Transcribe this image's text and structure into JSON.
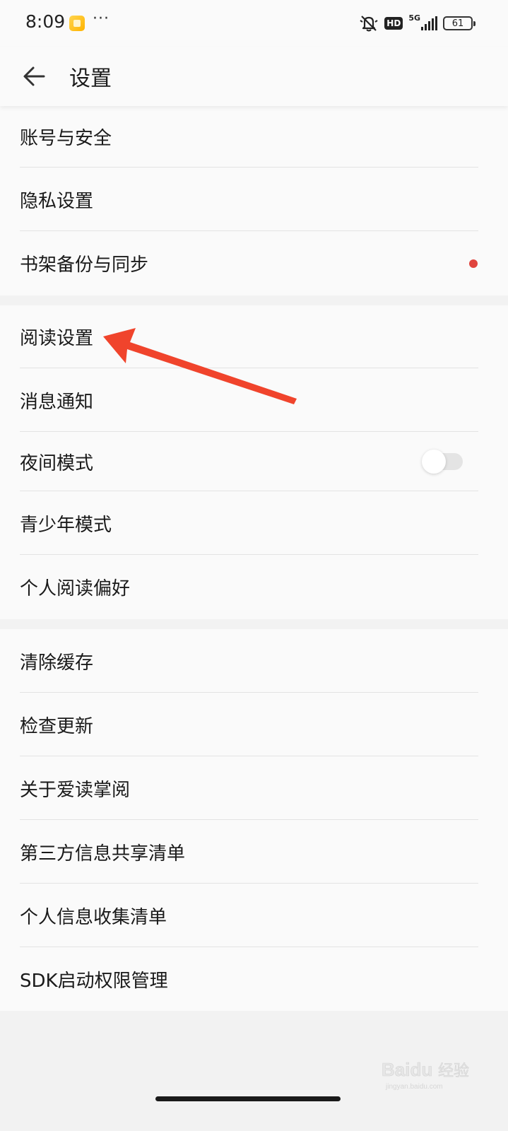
{
  "status_bar": {
    "time": "8:09",
    "network_badge": "HD",
    "network_type": "5G",
    "battery_level": "61",
    "more_dots": "···"
  },
  "app_bar": {
    "title": "设置",
    "back_icon": "arrow-left-icon"
  },
  "groups": [
    {
      "items": [
        {
          "label": "账号与安全"
        },
        {
          "label": "隐私设置"
        },
        {
          "label": "书架备份与同步",
          "badge": "red-dot"
        }
      ]
    },
    {
      "items": [
        {
          "label": "阅读设置"
        },
        {
          "label": "消息通知"
        },
        {
          "label": "夜间模式",
          "toggle": false
        },
        {
          "label": "青少年模式"
        },
        {
          "label": "个人阅读偏好"
        }
      ]
    },
    {
      "items": [
        {
          "label": "清除缓存"
        },
        {
          "label": "检查更新"
        },
        {
          "label": "关于爱读掌阅"
        },
        {
          "label": "第三方信息共享清单"
        },
        {
          "label": "个人信息收集清单"
        },
        {
          "label": "SDK启动权限管理"
        }
      ]
    }
  ],
  "watermark": {
    "brand": "Baidu",
    "suffix": "经验",
    "domain": "jingyan.baidu.com"
  },
  "colors": {
    "background": "#f2f2f2",
    "card": "#fafafa",
    "divider": "#e3e3e3",
    "red_dot": "#e0443e",
    "annotation_arrow": "#f0442c"
  }
}
